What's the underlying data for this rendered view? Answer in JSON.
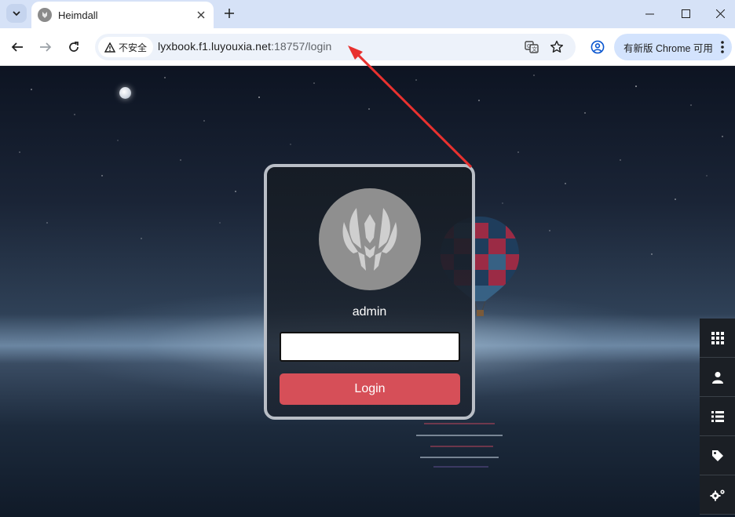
{
  "browser": {
    "tab": {
      "title": "Heimdall"
    },
    "omnibox": {
      "security_label": "不安全",
      "url_host": "lyxbook.f1.luyouxia.net",
      "url_rest": ":18757/login"
    },
    "update_button_label": "有新版 Chrome 可用"
  },
  "login": {
    "username": "admin",
    "password_value": "",
    "login_button_label": "Login"
  },
  "side_menu": {
    "items": [
      "apps-grid-icon",
      "user-icon",
      "list-icon",
      "tag-icon",
      "settings-cogs-icon"
    ]
  },
  "colors": {
    "login_button": "#d64f58",
    "annotation_arrow": "#e8312f",
    "update_button": "#d3e3fd"
  }
}
